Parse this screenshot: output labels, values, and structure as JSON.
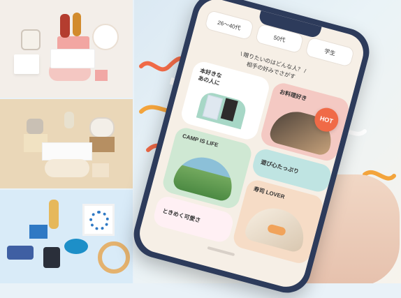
{
  "tabs": [
    "26〜40代",
    "50代",
    "学生"
  ],
  "prompt": {
    "line1": "\\ 贈りたいのはどんな人？ /",
    "line2": "相手の好みでさがす"
  },
  "cards": {
    "book_lovers": "本好きな\nあの人に",
    "cooking": "お料理好き",
    "camp": "CAMP IS LIFE",
    "playful": "遊び心たっぷり",
    "sushi": "寿司 LOVER",
    "cute": "ときめく可愛さ"
  },
  "badge": "HOT",
  "colors": {
    "accent": "#f06a47",
    "phone": "#2d3b5b",
    "screen": "#f6efe6"
  }
}
